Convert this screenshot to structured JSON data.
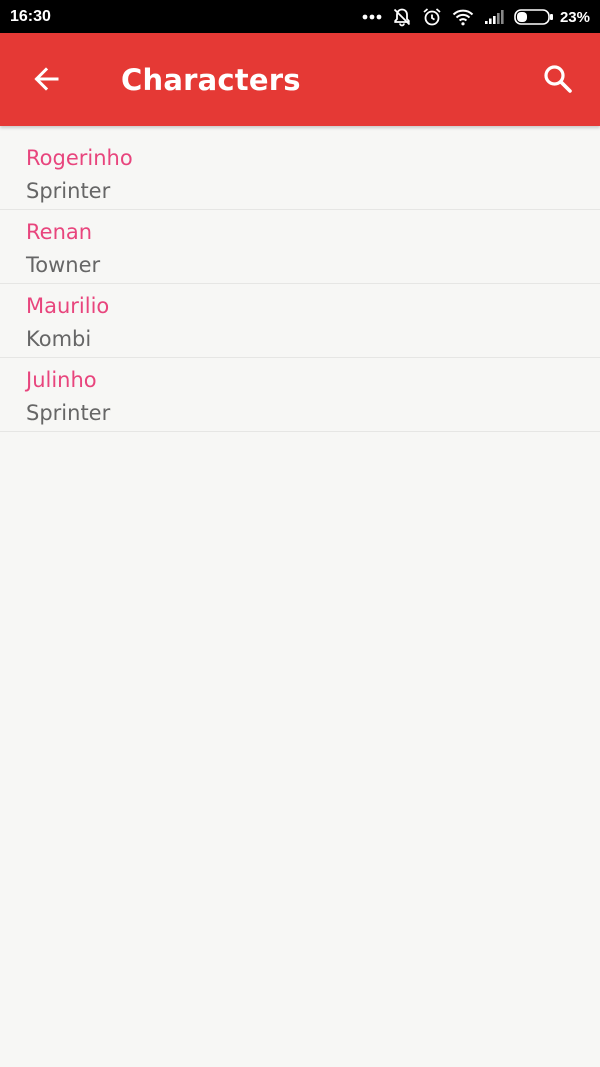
{
  "status_bar": {
    "time": "16:30",
    "icons": [
      "more-dots-icon",
      "notifications-off-icon",
      "alarm-icon",
      "wifi-icon",
      "signal-icon",
      "battery-icon"
    ],
    "battery_percent": "23%",
    "battery_level": 0.23
  },
  "app_bar": {
    "title": "Characters",
    "back_icon": "arrow-back-icon",
    "search_icon": "search-icon",
    "color": "#e53935"
  },
  "colors": {
    "name_text": "#e8457d",
    "secondary_text": "#666666",
    "background": "#f7f7f5"
  },
  "characters": [
    {
      "name": "Rogerinho",
      "vehicle": "Sprinter"
    },
    {
      "name": "Renan",
      "vehicle": "Towner"
    },
    {
      "name": "Maurilio",
      "vehicle": "Kombi"
    },
    {
      "name": "Julinho",
      "vehicle": "Sprinter"
    }
  ]
}
